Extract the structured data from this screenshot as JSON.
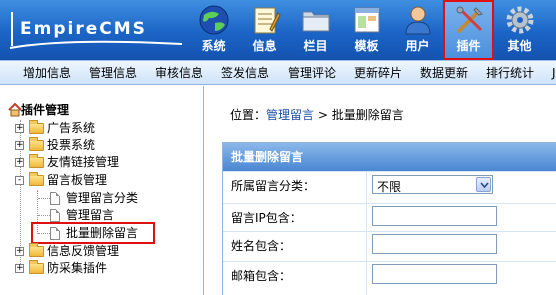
{
  "app": {
    "logo_text": "EmpireCMS"
  },
  "nav": {
    "items": [
      {
        "label": "系统",
        "icon": "globe-icon"
      },
      {
        "label": "信息",
        "icon": "notepad-icon"
      },
      {
        "label": "栏目",
        "icon": "folder-icon"
      },
      {
        "label": "模板",
        "icon": "window-icon"
      },
      {
        "label": "用户",
        "icon": "user-icon"
      },
      {
        "label": "插件",
        "icon": "tools-icon",
        "active": true
      },
      {
        "label": "其他",
        "icon": "gear-icon"
      }
    ]
  },
  "submenu": {
    "items": [
      "增加信息",
      "管理信息",
      "审核信息",
      "签发信息",
      "管理评论",
      "更新碎片",
      "数据更新",
      "排行统计",
      "J"
    ]
  },
  "tree": {
    "title": "插件管理",
    "items": [
      {
        "label": "广告系统",
        "type": "folder",
        "toggle": "+"
      },
      {
        "label": "投票系统",
        "type": "folder",
        "toggle": "+"
      },
      {
        "label": "友情链接管理",
        "type": "folder",
        "toggle": "+"
      },
      {
        "label": "留言板管理",
        "type": "folder",
        "toggle": "-"
      },
      {
        "label": "管理留言分类",
        "type": "page"
      },
      {
        "label": "管理留言",
        "type": "page"
      },
      {
        "label": "批量删除留言",
        "type": "page",
        "selected": true
      },
      {
        "label": "信息反馈管理",
        "type": "folder",
        "toggle": "+"
      },
      {
        "label": "防采集插件",
        "type": "folder",
        "toggle": "+"
      }
    ]
  },
  "breadcrumb": {
    "prefix": "位置：",
    "link": "管理留言",
    "sep": " > ",
    "current": "批量删除留言"
  },
  "form": {
    "title": "批量删除留言",
    "fields": {
      "category_label": "所属留言分类：",
      "category_value": "不限",
      "ip_label": "留言IP包含：",
      "ip_value": "",
      "name_label": "姓名包含：",
      "name_value": "",
      "email_label": "邮箱包含：",
      "email_value": ""
    }
  },
  "colors": {
    "header": "#1b64c6",
    "highlight": "#e01010",
    "link": "#1b4ea0"
  }
}
